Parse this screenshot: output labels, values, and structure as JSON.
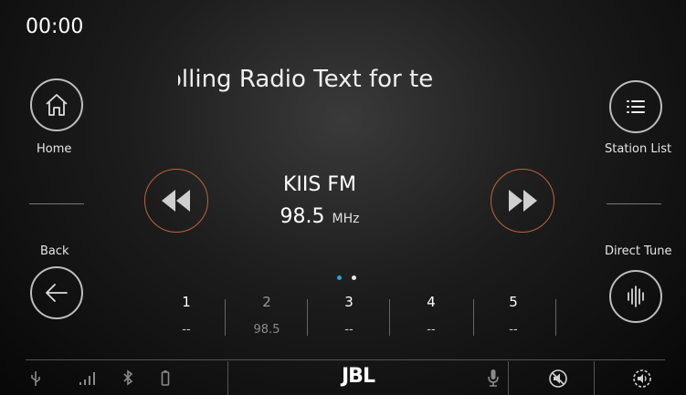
{
  "status": {
    "time": "00:00"
  },
  "radio_text": "olling   Radio Text for te",
  "left_controls": {
    "home_label": "Home",
    "back_label": "Back"
  },
  "right_controls": {
    "station_list_label": "Station List",
    "direct_tune_label": "Direct Tune"
  },
  "station": {
    "name": "KIIS FM",
    "frequency": "98.5",
    "unit": "MHz"
  },
  "page_indicator": {
    "total": 2,
    "active": 1,
    "active_color": "#1fa7e0"
  },
  "presets": [
    {
      "number": "1",
      "value": "--"
    },
    {
      "number": "2",
      "value": "98.5"
    },
    {
      "number": "3",
      "value": "--"
    },
    {
      "number": "4",
      "value": "--"
    },
    {
      "number": "5",
      "value": "--"
    }
  ],
  "bottom_bar": {
    "brand": "JBL",
    "icons": [
      "usb-icon",
      "signal-bars-icon",
      "bluetooth-icon",
      "battery-icon",
      "microphone-icon",
      "mute-icon",
      "volume-icon"
    ]
  },
  "colors": {
    "seek_ring": "#c0623a",
    "accent": "#1fa7e0"
  }
}
